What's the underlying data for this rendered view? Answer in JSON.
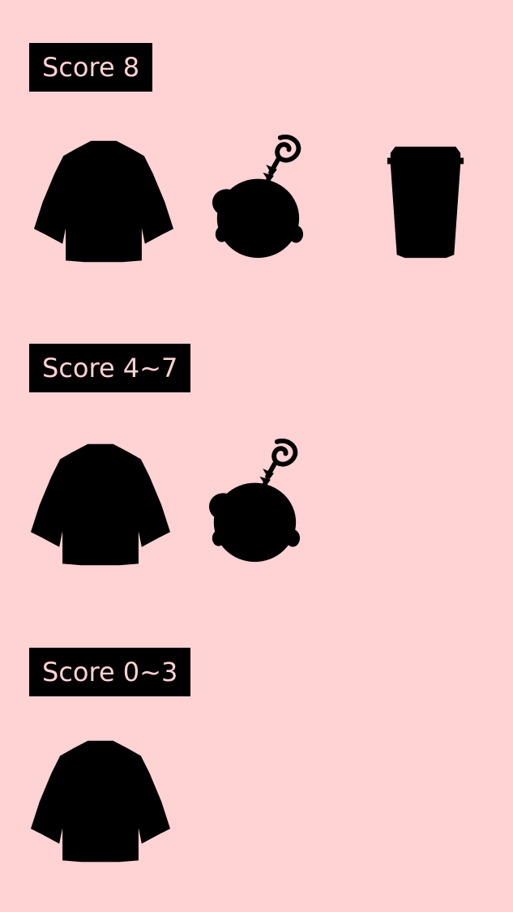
{
  "tiers": [
    {
      "label": "Score 8",
      "rewards": [
        {
          "icon": "jacket-icon"
        },
        {
          "icon": "keychain-icon"
        },
        {
          "icon": "cup-icon"
        }
      ]
    },
    {
      "label": "Score 4~7",
      "rewards": [
        {
          "icon": "jacket-icon"
        },
        {
          "icon": "keychain-icon"
        }
      ]
    },
    {
      "label": "Score 0~3",
      "rewards": [
        {
          "icon": "jacket-icon"
        }
      ]
    }
  ],
  "colors": {
    "background": "#ffd2d4",
    "label_background": "#000000",
    "label_text": "#ffd2d4",
    "silhouette": "#000000"
  }
}
